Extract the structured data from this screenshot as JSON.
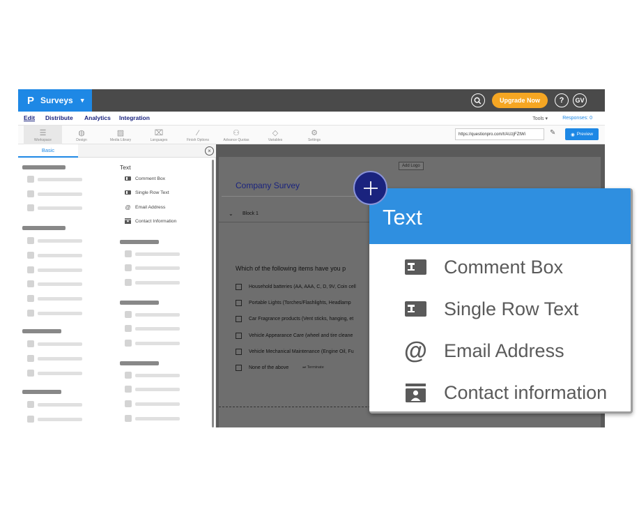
{
  "topbar": {
    "logo": "P",
    "app_name": "Surveys",
    "upgrade_label": "Upgrade Now",
    "help_label": "?",
    "avatar_initials": "GV"
  },
  "nav": {
    "items": [
      "Edit",
      "Distribute",
      "Analytics",
      "Integration"
    ],
    "tools_label": "Tools",
    "responses_label": "Responses: 0"
  },
  "toolbar": {
    "items": [
      {
        "label": "Workspace",
        "icon": "workspace-icon"
      },
      {
        "label": "Design",
        "icon": "palette-icon"
      },
      {
        "label": "Media Library",
        "icon": "image-icon"
      },
      {
        "label": "Languages",
        "icon": "translate-icon"
      },
      {
        "label": "Finish Options",
        "icon": "wand-icon"
      },
      {
        "label": "Advance Quotas",
        "icon": "quota-icon"
      },
      {
        "label": "Variables",
        "icon": "tag-icon"
      },
      {
        "label": "Settings",
        "icon": "gear-icon"
      }
    ],
    "url": "https://questionpro.com/t/AUzjFZtWi",
    "preview_label": "Preview"
  },
  "left_panel": {
    "tab_basic": "Basic",
    "text_section": {
      "heading": "Text",
      "items": [
        "Comment Box",
        "Single Row Text",
        "Email Address",
        "Contact Information"
      ]
    }
  },
  "canvas": {
    "add_logo": "Add Logo",
    "survey_title": "Company Survey",
    "block_label": "Block 1",
    "question": "Which of the following items have you p",
    "options": [
      "Household batteries (AA, AAA, C, D, 9V, Coin cell",
      "Portable Lights (Torches/Flashlights, Headlamp",
      "Car Fragrance products (Vent sticks, hanging, et",
      "Vehicle Appearance Care (wheel and tire cleane",
      "Vehicle Mechanical Maintenance (Engine Oil, Fu",
      "None of the above"
    ],
    "terminate_label": "Terminate"
  },
  "popup": {
    "title": "Text",
    "items": [
      {
        "label": "Comment Box",
        "icon": "comment-box-icon"
      },
      {
        "label": "Single Row Text",
        "icon": "single-row-text-icon"
      },
      {
        "label": "Email Address",
        "icon": "at-sign-icon"
      },
      {
        "label": "Contact information",
        "icon": "contact-card-icon"
      }
    ]
  },
  "colors": {
    "brand_blue": "#1e88e5",
    "popup_header": "#2f8fe0",
    "plus_button": "#1a237e",
    "upgrade": "#f5a623",
    "topbar": "#4a4a4a"
  }
}
